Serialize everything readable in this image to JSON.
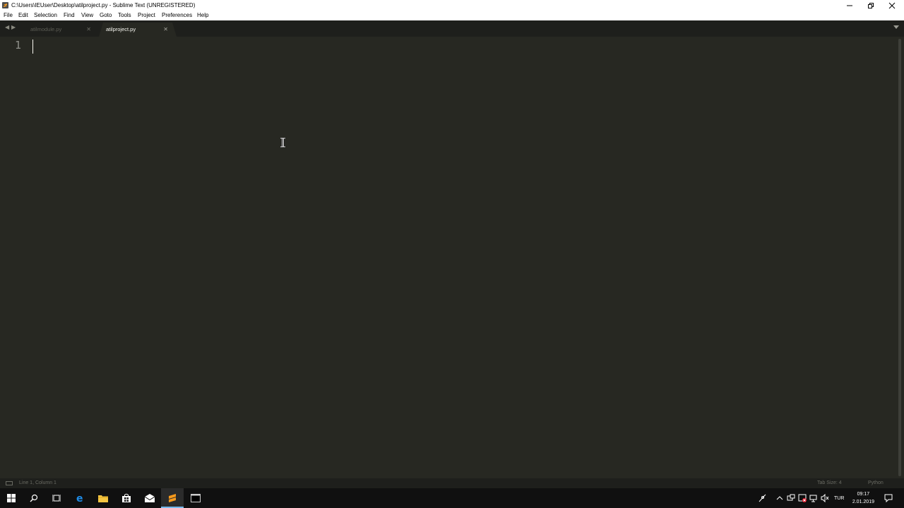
{
  "window": {
    "title": "C:\\Users\\IEUser\\Desktop\\atilproject.py - Sublime Text (UNREGISTERED)"
  },
  "menu": [
    "File",
    "Edit",
    "Selection",
    "Find",
    "View",
    "Goto",
    "Tools",
    "Project",
    "Preferences",
    "Help"
  ],
  "tabs": [
    {
      "label": "atilmodule.py",
      "active": false
    },
    {
      "label": "atilproject.py",
      "active": true
    }
  ],
  "editor": {
    "line_numbers": [
      "1"
    ]
  },
  "statusbar": {
    "position": "Line 1, Column 1",
    "tab_size": "Tab Size: 4",
    "syntax": "Python"
  },
  "taskbar": {
    "language": "TUR",
    "time": "09:17",
    "date": "2.01.2019"
  },
  "colors": {
    "editor_bg": "#272822",
    "tabbar_bg": "#1e1f1c",
    "taskbar_bg": "#101010",
    "accent": "#76b9ed"
  }
}
